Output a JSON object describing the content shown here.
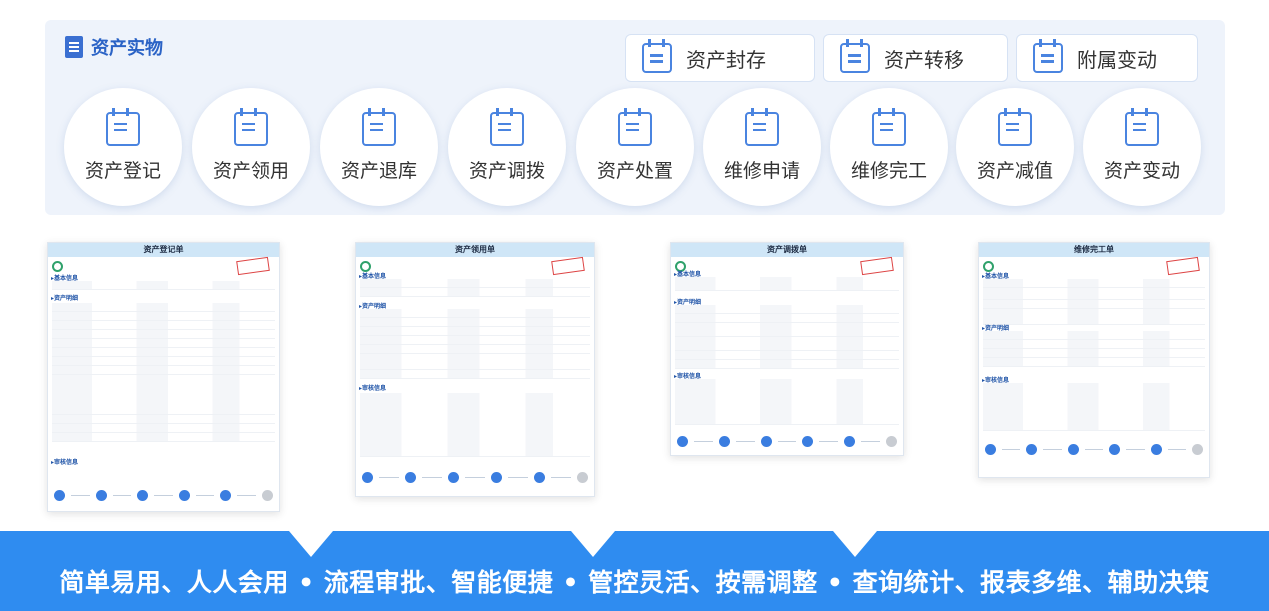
{
  "section_title": "资产实物",
  "top_actions": [
    {
      "label": "资产封存",
      "icon": "calendar-list-icon"
    },
    {
      "label": "资产转移",
      "icon": "calendar-list-icon"
    },
    {
      "label": "附属变动",
      "icon": "calendar-list-icon"
    }
  ],
  "modules": [
    {
      "label": "资产登记",
      "icon": "calendar-list-icon"
    },
    {
      "label": "资产领用",
      "icon": "calendar-list-icon"
    },
    {
      "label": "资产退库",
      "icon": "calendar-list-icon"
    },
    {
      "label": "资产调拨",
      "icon": "calendar-list-icon"
    },
    {
      "label": "资产处置",
      "icon": "calendar-list-icon"
    },
    {
      "label": "维修申请",
      "icon": "calendar-list-icon"
    },
    {
      "label": "维修完工",
      "icon": "calendar-list-icon"
    },
    {
      "label": "资产减值",
      "icon": "calendar-list-icon"
    },
    {
      "label": "资产变动",
      "icon": "calendar-list-icon"
    }
  ],
  "forms": [
    {
      "title": "资产登记单",
      "sections": [
        "▸基本信息",
        "▸资产明细",
        "▸审核信息"
      ]
    },
    {
      "title": "资产领用单",
      "sections": [
        "▸基本信息",
        "▸资产明细",
        "▸审核信息"
      ]
    },
    {
      "title": "资产调拨单",
      "sections": [
        "▸基本信息",
        "▸资产明细",
        "▸审核信息"
      ]
    },
    {
      "title": "维修完工单",
      "sections": [
        "▸基本信息",
        "▸资产明细",
        "▸审核信息"
      ]
    }
  ],
  "slogan": "简单易用、人人会用 • 流程审批、智能便捷 • 管控灵活、按需调整 • 查询统计、报表多维、辅助决策",
  "colors": {
    "accent": "#2f8cf0",
    "panel": "#eef3fb",
    "title": "#2b63c6"
  }
}
